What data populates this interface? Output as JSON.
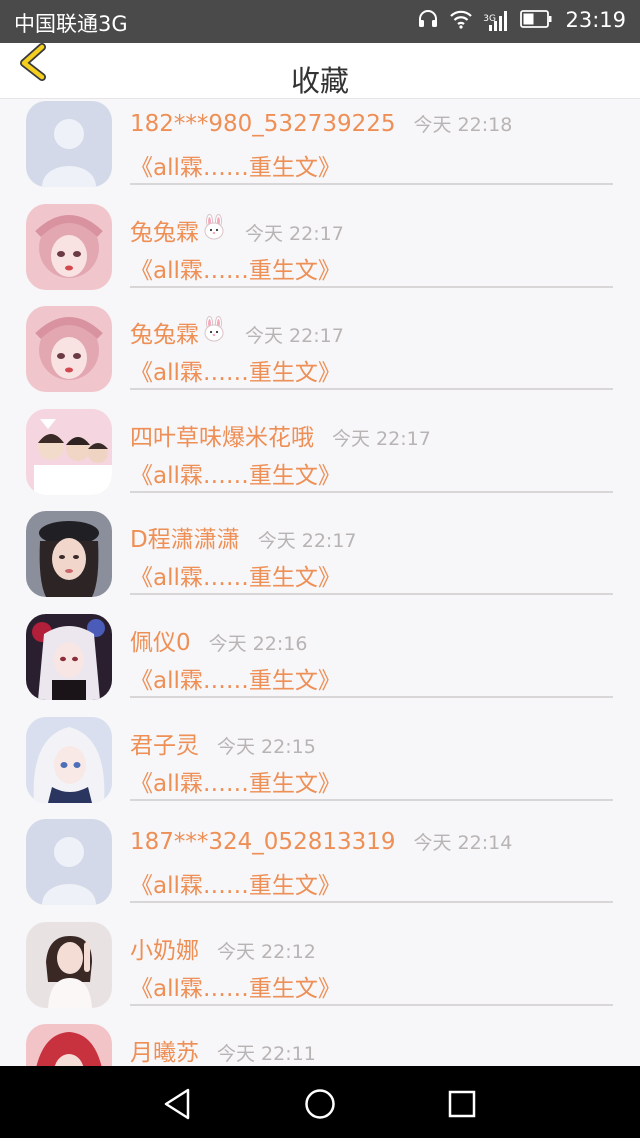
{
  "status_bar": {
    "carrier": "中国联通3G",
    "network_type": "3G",
    "time": "23:19",
    "icons": [
      "headset-icon",
      "wifi-icon",
      "signal-icon",
      "battery-icon"
    ]
  },
  "header": {
    "title": "收藏",
    "back_icon": "chevron-left-icon",
    "accent_color": "#f5cf1f"
  },
  "list": {
    "name_color": "#ee8f55",
    "time_color": "#b9b4b4",
    "items": [
      {
        "name": "182***980_532739225",
        "time": "今天 22:18",
        "title": "《all霖……重生文》",
        "avatar": "default-avatar",
        "emoji": false
      },
      {
        "name": "兔兔霖",
        "time": "今天 22:17",
        "title": "《all霖……重生文》",
        "avatar": "anime-girl-pink",
        "emoji": true
      },
      {
        "name": "兔兔霖",
        "time": "今天 22:17",
        "title": "《all霖……重生文》",
        "avatar": "anime-girl-pink",
        "emoji": true
      },
      {
        "name": "四叶草味爆米花哦",
        "time": "今天 22:17",
        "title": "《all霖……重生文》",
        "avatar": "group-photo",
        "emoji": false
      },
      {
        "name": "D程潇潇潇",
        "time": "今天 22:17",
        "title": "《all霖……重生文》",
        "avatar": "girl-beret-photo",
        "emoji": false
      },
      {
        "name": "佩仪0",
        "time": "今天 22:16",
        "title": "《all霖……重生文》",
        "avatar": "anime-girl-roses",
        "emoji": false
      },
      {
        "name": "君子灵",
        "time": "今天 22:15",
        "title": "《all霖……重生文》",
        "avatar": "anime-girl-white-hair",
        "emoji": false
      },
      {
        "name": "187***324_052813319",
        "time": "今天 22:14",
        "title": "《all霖……重生文》",
        "avatar": "default-avatar",
        "emoji": false
      },
      {
        "name": "小奶娜",
        "time": "今天 22:12",
        "title": "《all霖……重生文》",
        "avatar": "girl-white-dress-photo",
        "emoji": false
      },
      {
        "name": "月曦苏",
        "time": "今天 22:11",
        "title": "",
        "avatar": "red-hair-avatar",
        "emoji": false
      }
    ]
  },
  "nav_bar": {
    "icons": [
      "back-triangle-icon",
      "home-circle-icon",
      "recents-square-icon"
    ]
  }
}
